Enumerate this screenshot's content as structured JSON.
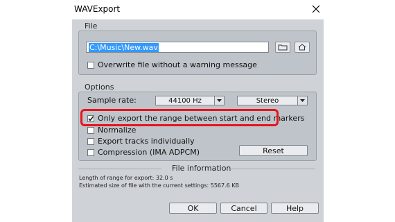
{
  "window": {
    "title": "WAVExport"
  },
  "file": {
    "section_label": "File",
    "path": "C:\\Music\\New.wav",
    "overwrite_label": "Overwrite file without a warning message"
  },
  "options": {
    "section_label": "Options",
    "sample_rate_label": "Sample rate:",
    "sample_rate_value": "44100 Hz",
    "channels_value": "Stereo",
    "range_label": "Only export the range between start and end markers",
    "normalize_label": "Normalize",
    "tracks_label": "Export tracks individually",
    "compression_label": "Compression (IMA ADPCM)",
    "reset_label": "Reset"
  },
  "info": {
    "section_label": "File information",
    "length_line": "Length of range for export: 32.0 s",
    "size_line": "Estimated size of file with the current settings: 5567.6 KB"
  },
  "buttons": {
    "ok": "OK",
    "cancel": "Cancel",
    "help": "Help"
  },
  "colors": {
    "highlight": "#e8131b",
    "selection": "#3399ff",
    "dialog_bg": "#cfd3d8"
  }
}
